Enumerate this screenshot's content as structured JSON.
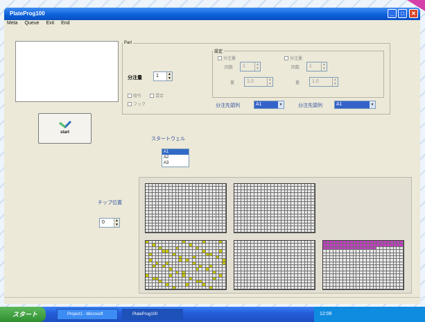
{
  "window": {
    "title": "PlateProg100",
    "btn_min": "_",
    "btn_max": "□",
    "btn_close": "✕"
  },
  "menu": [
    "Meta",
    "Queue",
    "Exit",
    "End"
  ],
  "fieldset": {
    "legend": "Part"
  },
  "left_panel": {
    "dispense_label": "分注量",
    "dispense_value": "1",
    "chk1": "吸引",
    "chk2": "混合",
    "chk3": "フック"
  },
  "settings": {
    "title": "設定",
    "opt1": "分注量",
    "opt2": "分注量",
    "count1_label": "回数",
    "count1_value": "1",
    "count2_label": "回数",
    "count2_value": "1",
    "amount1_label": "量",
    "amount1_value": "1.0",
    "amount2_label": "量",
    "amount2_value": "1.0",
    "dir1_label": "分注先頭列",
    "dir1_value": "A1",
    "dir2_label": "分注先頭列",
    "dir2_value": "A1"
  },
  "start": {
    "label": "start"
  },
  "start_well": {
    "label": "スタートウェル",
    "items": [
      "A1",
      "A2",
      "A3"
    ],
    "selected": 0
  },
  "chip": {
    "label": "チップ位置",
    "value": "0"
  },
  "taskbar": {
    "start": "スタート",
    "task1": "Project1 - Microsoft",
    "task2": "PlateProg100",
    "tray_time": "12:08"
  },
  "colors": {
    "title_bar": "#0a5fd8",
    "well_yellow": "#c7c400",
    "well_magenta": "#c43cc4"
  }
}
